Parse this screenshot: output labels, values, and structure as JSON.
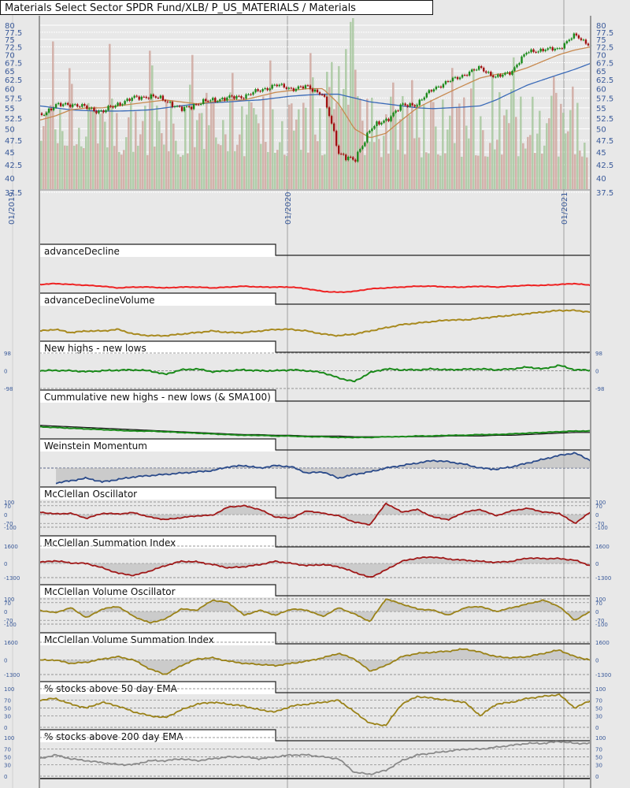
{
  "title": "Materials Select Sector SPDR Fund/XLB/ P_US_MATERIALS / Materials",
  "x_axis": {
    "date_labels": [
      "01/2019",
      "01/2020",
      "01/2021"
    ]
  },
  "colors": {
    "up": "#1a8a1a",
    "down": "#a01010",
    "sma50": "#c88a50",
    "sma200": "#3a6ab8",
    "vol_up": "#a8c8a0",
    "vol_down": "#cfa8a0"
  },
  "chart_data": [
    {
      "type": "candlestick",
      "title": "Materials Select Sector SPDR Fund/XLB/ P_US_MATERIALS / Materials",
      "yscale": "log",
      "ylim": [
        37.5,
        80
      ],
      "yticks": [
        "37.5",
        "40",
        "42.5",
        "45",
        "47.5",
        "50",
        "52.5",
        "55",
        "57.5",
        "60",
        "62.5",
        "65",
        "67.5",
        "70",
        "72.5",
        "75",
        "77.5",
        "80"
      ],
      "series": [
        {
          "name": "close",
          "values": [
            53,
            55.5,
            56,
            55,
            54,
            56,
            57.5,
            58,
            57,
            54.5,
            56,
            57,
            57.5,
            58,
            59.5,
            61,
            60,
            60.5,
            58.5,
            45,
            43,
            50,
            52,
            55.5,
            56,
            60,
            62,
            64,
            66,
            63,
            65,
            71,
            71.5,
            72,
            76.5,
            73
          ]
        },
        {
          "name": "SMA50",
          "values": [
            52,
            53,
            54.5,
            55,
            55,
            55.5,
            56,
            56.5,
            57,
            56.5,
            56,
            56.5,
            57,
            57,
            58,
            59,
            59.5,
            60,
            60,
            56,
            50,
            48,
            49,
            52,
            55,
            57,
            59,
            61,
            63,
            64,
            64.5,
            66,
            68,
            70,
            71.5,
            72.5
          ]
        },
        {
          "name": "SMA200",
          "values": [
            55.5,
            55,
            54.5,
            54.3,
            54.2,
            54.2,
            54.3,
            54.5,
            55,
            55.5,
            56,
            56.3,
            56.5,
            56.8,
            57,
            57.5,
            58,
            58.3,
            58.5,
            58.5,
            57.5,
            56.5,
            56,
            55.5,
            55,
            54.8,
            55,
            55.2,
            55.5,
            57,
            59,
            61,
            62.5,
            64,
            65.5,
            67.3
          ]
        }
      ]
    },
    {
      "type": "line",
      "title": "advanceDecline",
      "ylim": [
        0,
        10
      ],
      "yticks": [],
      "color": "#ee2222",
      "fill": false,
      "values": [
        5,
        5.5,
        5,
        4.5,
        4,
        3,
        3.5,
        3.5,
        3,
        3.5,
        3.5,
        3,
        3.5,
        4,
        3.5,
        3.5,
        3.5,
        2.5,
        1,
        0.5,
        1,
        2.5,
        3,
        3.5,
        4,
        4,
        3.5,
        3.5,
        4,
        3.5,
        4,
        4.5,
        4.5,
        5,
        5.5,
        4.5
      ]
    },
    {
      "type": "line",
      "title": "advanceDeclineVolume",
      "ylim": [
        0,
        10
      ],
      "yticks": [],
      "color": "#a88a20",
      "fill": false,
      "values": [
        2,
        2.5,
        1.5,
        2,
        2,
        2.5,
        1,
        0.5,
        0.5,
        1,
        1.5,
        2,
        1.5,
        1.5,
        2,
        2.5,
        2.5,
        2,
        1,
        0.5,
        1,
        2,
        3,
        4,
        4.5,
        5,
        5.5,
        5.5,
        6,
        6.5,
        7,
        7.5,
        8,
        8.5,
        8.5,
        8
      ]
    },
    {
      "type": "line",
      "title": "New highs - new lows",
      "ylim": [
        -98,
        98
      ],
      "yticks": [
        "98",
        "0",
        "-98"
      ],
      "color": "#1a8a1a",
      "fill": false,
      "values": [
        0,
        2,
        0,
        -5,
        0,
        3,
        5,
        0,
        -20,
        5,
        10,
        -5,
        0,
        5,
        0,
        0,
        5,
        0,
        -10,
        -40,
        -60,
        -10,
        10,
        5,
        5,
        10,
        5,
        8,
        10,
        5,
        10,
        20,
        10,
        30,
        5,
        3
      ]
    },
    {
      "type": "line",
      "title": "Cummulative new highs - new lows (& SMA100)",
      "ylim": [
        0,
        10
      ],
      "yticks": [],
      "color": "#1a8a1a",
      "fill": false,
      "values": [
        8,
        7.5,
        7,
        6.5,
        6,
        5.5,
        5,
        5,
        4.5,
        4,
        3.5,
        3,
        2.5,
        2,
        2,
        1.5,
        1.5,
        1,
        1,
        0.5,
        0.5,
        0.5,
        1,
        1,
        1.5,
        1.5,
        2,
        2,
        2.5,
        2.5,
        3,
        3.5,
        4,
        4.5,
        5,
        5
      ],
      "sma": [
        9,
        8.5,
        8,
        7.5,
        7,
        6.5,
        6,
        5.5,
        5,
        4.5,
        4,
        3.5,
        3,
        2.5,
        2.5,
        2,
        2,
        1.5,
        1.5,
        1.5,
        1,
        1,
        1,
        1,
        1,
        1,
        1.5,
        1.5,
        1.5,
        2,
        2,
        2.5,
        3,
        3.5,
        4,
        4
      ]
    },
    {
      "type": "area",
      "title": "Weinstein Momentum",
      "ylim": [
        -1.5,
        1.5
      ],
      "yticks": [],
      "color": "#2a4a8a",
      "fill": true,
      "values": [
        null,
        -1.2,
        -1,
        -0.8,
        -1.1,
        -0.9,
        -0.7,
        -0.6,
        -0.5,
        -0.4,
        -0.3,
        -0.2,
        0.1,
        0.2,
        0,
        0.2,
        0.1,
        -0.4,
        -0.3,
        -0.8,
        -0.5,
        -0.3,
        0,
        0.2,
        0.4,
        0.6,
        0.5,
        0.3,
        0,
        -0.1,
        0.1,
        0.4,
        0.7,
        1.0,
        1.2,
        0.6
      ]
    },
    {
      "type": "area",
      "title": "McClellan Oscillator",
      "ylim": [
        -100,
        100
      ],
      "yticks": [
        "100",
        "70",
        "0",
        "-70",
        "-100"
      ],
      "color": "#a01818",
      "fill": true,
      "values": [
        20,
        5,
        10,
        -30,
        10,
        5,
        15,
        -20,
        -40,
        -25,
        -10,
        -5,
        60,
        70,
        40,
        -20,
        -30,
        30,
        10,
        -10,
        -60,
        -80,
        90,
        20,
        40,
        -20,
        -40,
        20,
        40,
        -10,
        30,
        50,
        20,
        10,
        -70,
        20
      ]
    },
    {
      "type": "area",
      "title": "McClellan Summation Index",
      "ylim": [
        -1300,
        1600
      ],
      "yticks": [
        "1600",
        "0",
        "-1300"
      ],
      "color": "#a01818",
      "fill": true,
      "values": [
        100,
        250,
        50,
        0,
        -400,
        -900,
        -1100,
        -700,
        -200,
        200,
        150,
        -100,
        -400,
        -300,
        -100,
        200,
        0,
        -200,
        -100,
        -300,
        -800,
        -1300,
        -600,
        200,
        500,
        600,
        400,
        300,
        200,
        100,
        200,
        500,
        450,
        450,
        300,
        -200
      ]
    },
    {
      "type": "area",
      "title": "McClellan Volume Oscillator",
      "ylim": [
        -100,
        100
      ],
      "yticks": [
        "100",
        "70",
        "0",
        "-70",
        "-100"
      ],
      "color": "#9a8218",
      "fill": true,
      "values": [
        10,
        -10,
        30,
        -50,
        20,
        40,
        -40,
        -90,
        -60,
        20,
        10,
        90,
        70,
        -30,
        10,
        -30,
        20,
        10,
        -40,
        30,
        -20,
        -80,
        100,
        60,
        20,
        10,
        -30,
        30,
        40,
        0,
        30,
        60,
        90,
        40,
        -70,
        0
      ]
    },
    {
      "type": "area",
      "title": "McClellan Volume Summation Index",
      "ylim": [
        -1300,
        1600
      ],
      "yticks": [
        "1600",
        "0",
        "-1300"
      ],
      "color": "#9a8218",
      "fill": true,
      "values": [
        0,
        0,
        -300,
        -200,
        100,
        300,
        0,
        -800,
        -1300,
        -500,
        100,
        200,
        -100,
        -300,
        -400,
        -500,
        -300,
        -100,
        200,
        600,
        100,
        -1000,
        -500,
        300,
        600,
        700,
        800,
        1000,
        700,
        300,
        200,
        300,
        600,
        900,
        300,
        0
      ]
    },
    {
      "type": "line",
      "title": "% stocks above 50 day EMA",
      "ylim": [
        0,
        100
      ],
      "yticks": [
        "100",
        "70",
        "50",
        "30",
        "0"
      ],
      "color": "#9a8218",
      "fill": false,
      "values": [
        70,
        75,
        60,
        50,
        65,
        55,
        40,
        30,
        25,
        45,
        60,
        65,
        60,
        55,
        45,
        40,
        55,
        60,
        65,
        70,
        40,
        10,
        5,
        60,
        80,
        75,
        70,
        65,
        30,
        60,
        65,
        75,
        80,
        85,
        50,
        70
      ]
    },
    {
      "type": "line",
      "title": "% stocks above 200 day EMA",
      "ylim": [
        0,
        100
      ],
      "yticks": [
        "100",
        "70",
        "50",
        "30",
        "0"
      ],
      "color": "#8a8a8a",
      "fill": false,
      "values": [
        45,
        55,
        45,
        40,
        35,
        30,
        30,
        40,
        40,
        45,
        40,
        45,
        50,
        50,
        45,
        50,
        55,
        55,
        50,
        45,
        10,
        5,
        15,
        40,
        55,
        60,
        65,
        70,
        70,
        75,
        80,
        85,
        85,
        90,
        85,
        85
      ]
    }
  ]
}
